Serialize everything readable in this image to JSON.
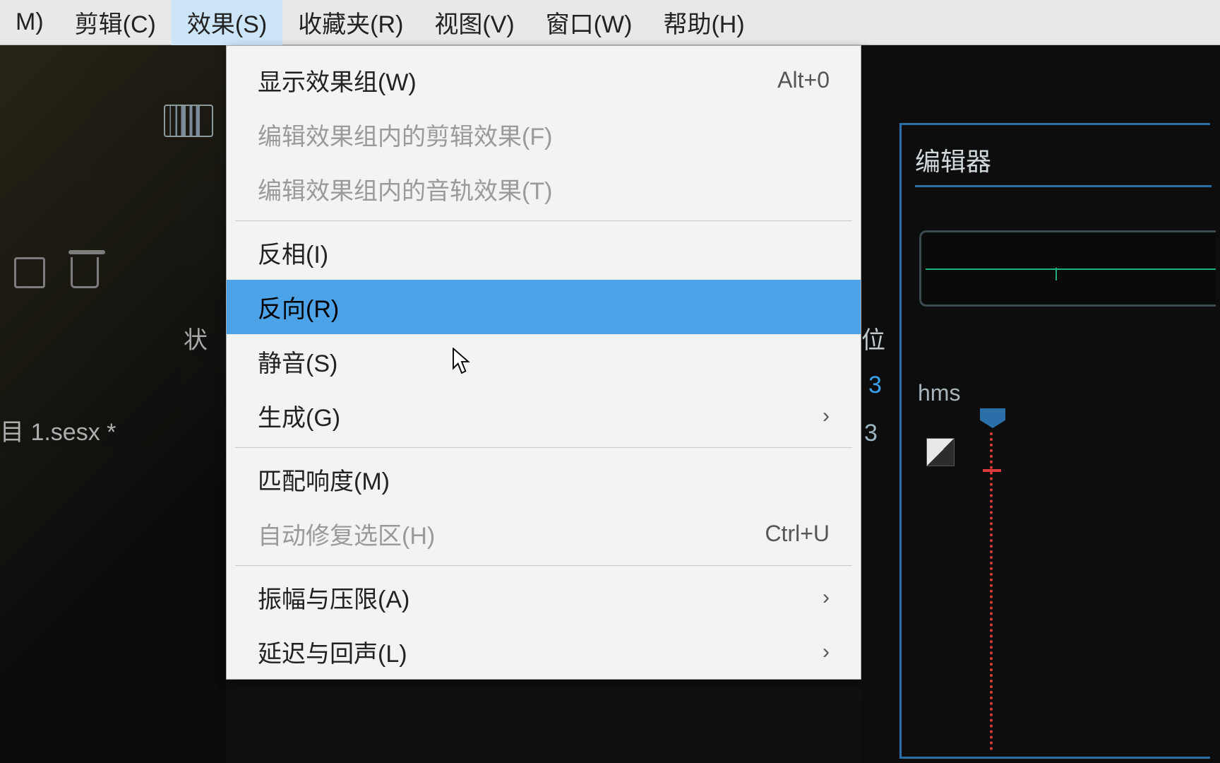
{
  "menubar": {
    "items": [
      {
        "label": "M)"
      },
      {
        "label": "剪辑(C)"
      },
      {
        "label": "效果(S)",
        "active": true
      },
      {
        "label": "收藏夹(R)"
      },
      {
        "label": "视图(V)"
      },
      {
        "label": "窗口(W)"
      },
      {
        "label": "帮助(H)"
      }
    ]
  },
  "dropdown": {
    "items": [
      {
        "label": "显示效果组(W)",
        "shortcut": "Alt+0",
        "enabled": true
      },
      {
        "label": "编辑效果组内的剪辑效果(F)",
        "enabled": false
      },
      {
        "label": "编辑效果组内的音轨效果(T)",
        "enabled": false
      },
      {
        "separator": true
      },
      {
        "label": "反相(I)",
        "enabled": true
      },
      {
        "label": "反向(R)",
        "enabled": true,
        "highlight": true
      },
      {
        "label": "静音(S)",
        "enabled": true
      },
      {
        "label": "生成(G)",
        "enabled": true,
        "submenu": true
      },
      {
        "separator": true
      },
      {
        "label": "匹配响度(M)",
        "enabled": true
      },
      {
        "label": "自动修复选区(H)",
        "shortcut": "Ctrl+U",
        "enabled": false
      },
      {
        "separator": true
      },
      {
        "label": "振幅与压限(A)",
        "enabled": true,
        "submenu": true
      },
      {
        "label": "延迟与回声(L)",
        "enabled": true,
        "submenu": true
      }
    ]
  },
  "left": {
    "status_label": "状",
    "file_label": "目 1.sesx *"
  },
  "right": {
    "editor_title": "编辑器",
    "wei": "位",
    "num1": "3",
    "num2": "3",
    "hms": "hms"
  }
}
